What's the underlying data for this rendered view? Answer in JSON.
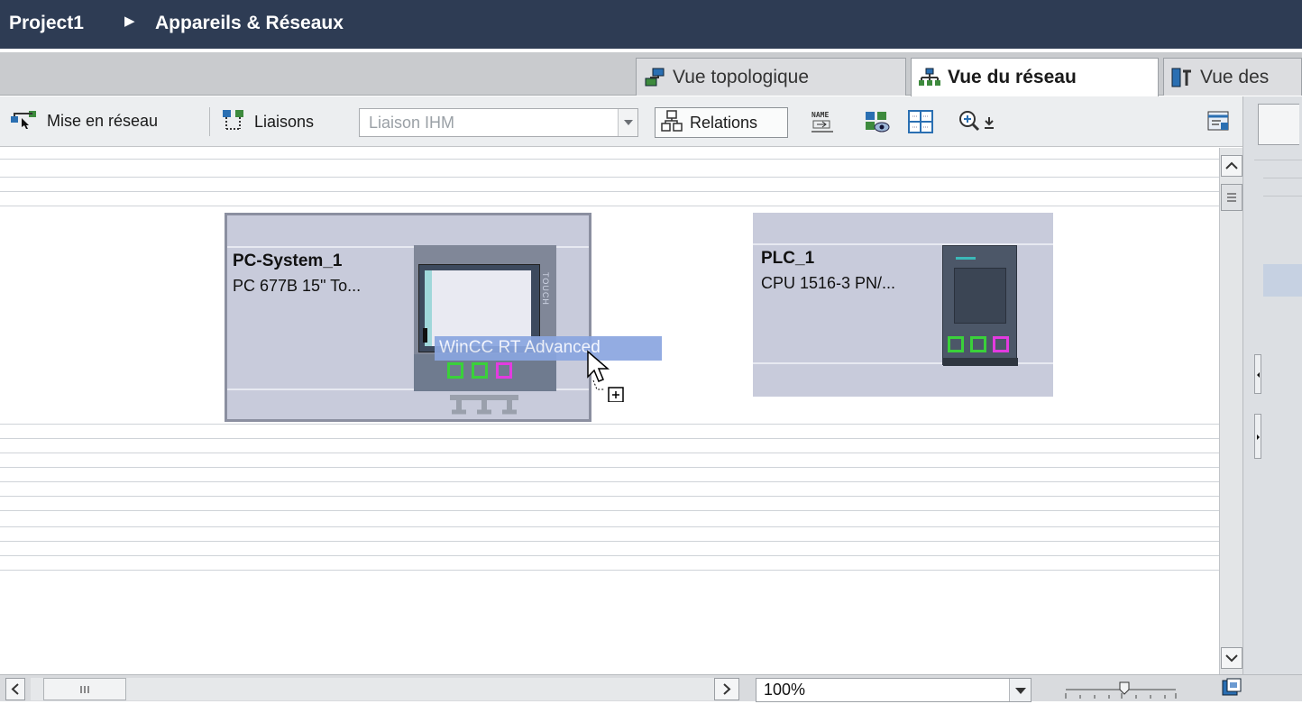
{
  "titlebar": {
    "project": "Project1",
    "separator": "▶",
    "section": "Appareils & Réseaux"
  },
  "tabs": [
    {
      "label": "Vue topologique",
      "icon": "topology-view-icon",
      "active": false
    },
    {
      "label": "Vue du réseau",
      "icon": "network-view-icon",
      "active": true
    },
    {
      "label": "Vue des",
      "icon": "device-view-icon",
      "active": false
    }
  ],
  "toolbar": {
    "networking_label": "Mise en réseau",
    "connections_label": "Liaisons",
    "connection_type_value": "Liaison IHM",
    "relations_label": "Relations"
  },
  "devices": [
    {
      "name": "PC-System_1",
      "type": "PC 677B 15\" To..."
    },
    {
      "name": "PLC_1",
      "type": "CPU 1516-3 PN/..."
    }
  ],
  "screen_side_label": "TOUCH",
  "drag_tooltip": "WinCC RT Advanced",
  "zoom": {
    "value": "100%"
  },
  "colors": {
    "titlebar_bg": "#2e3c54",
    "device_bg": "#c8cbdb",
    "port_green": "#3ad13a",
    "port_magenta": "#e33be0",
    "tooltip_bg": "#8aa6e0"
  }
}
